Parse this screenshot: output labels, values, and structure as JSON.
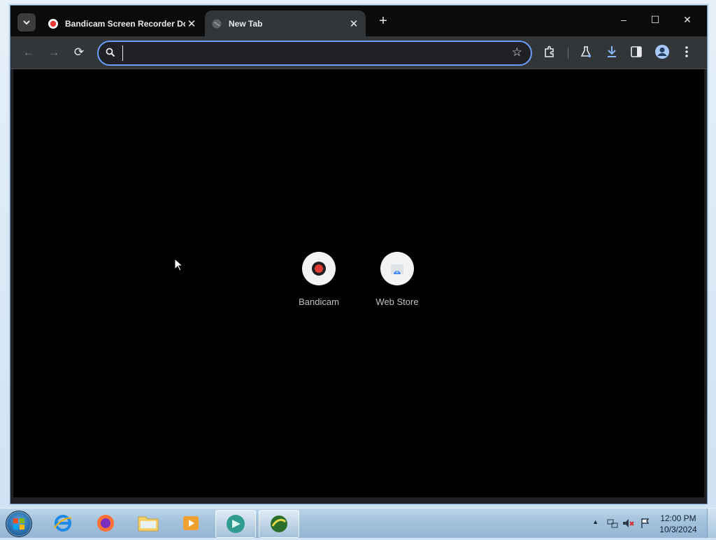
{
  "browser": {
    "tab_search_icon": "chevron-down-icon",
    "tabs": [
      {
        "title": "Bandicam Screen Recorder Do",
        "favicon": "bandicam-record-icon",
        "active": false
      },
      {
        "title": "New Tab",
        "favicon": "globe-icon",
        "active": true
      }
    ],
    "window_controls": {
      "minimize": "–",
      "maximize": "☐",
      "close": "✕"
    },
    "toolbar": {
      "back": "←",
      "forward": "→",
      "reload": "⟳",
      "address_value": "",
      "star": "☆"
    }
  },
  "new_tab": {
    "shortcuts": [
      {
        "label": "Bandicam"
      },
      {
        "label": "Web Store"
      }
    ]
  },
  "taskbar": {
    "clock_time": "12:00 PM",
    "clock_date": "10/3/2024",
    "tray_arrow": "▲"
  },
  "colors": {
    "accent": "#6c9ef8",
    "download": "#8ab4f8",
    "record_red": "#e53935"
  }
}
